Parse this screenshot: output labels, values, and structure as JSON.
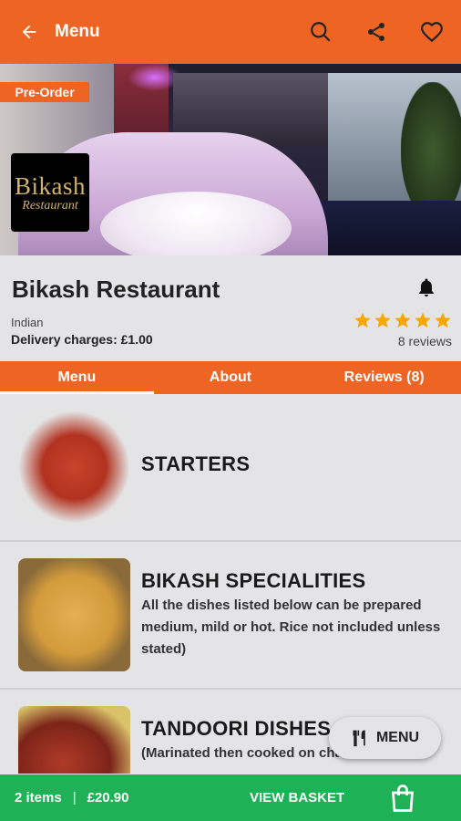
{
  "header": {
    "title": "Menu",
    "back_icon": "arrow-left-icon",
    "actions": [
      "search-icon",
      "share-icon",
      "heart-icon"
    ]
  },
  "banner": {
    "badge": "Pre-Order",
    "logo_line1": "Bikash",
    "logo_line2": "Restaurant"
  },
  "restaurant": {
    "name": "Bikash Restaurant",
    "cuisine": "Indian",
    "delivery": "Delivery charges: £1.00",
    "rating": 5,
    "reviews": "8 reviews"
  },
  "tabs": [
    {
      "label": "Menu",
      "active": true
    },
    {
      "label": "About",
      "active": false
    },
    {
      "label": "Reviews (8)",
      "active": false
    }
  ],
  "categories": [
    {
      "title": "STARTERS",
      "description": ""
    },
    {
      "title": "BIKASH SPECIALITIES",
      "description": "All the dishes listed below can be prepared medium, mild or hot. Rice not included unless stated)"
    },
    {
      "title": "TANDOORI DISHES",
      "description": "(Marinated then cooked on charcoal in a"
    }
  ],
  "fab": {
    "label": "MENU",
    "icon": "cutlery-icon"
  },
  "basket": {
    "items": "2 items",
    "separator": "|",
    "total": "£20.90",
    "action": "VIEW BASKET",
    "icon": "shopping-bag-icon"
  },
  "colors": {
    "brand": "#ee6423",
    "basket": "#1eb155",
    "star": "#f6a800",
    "background": "#e4e4e6"
  }
}
